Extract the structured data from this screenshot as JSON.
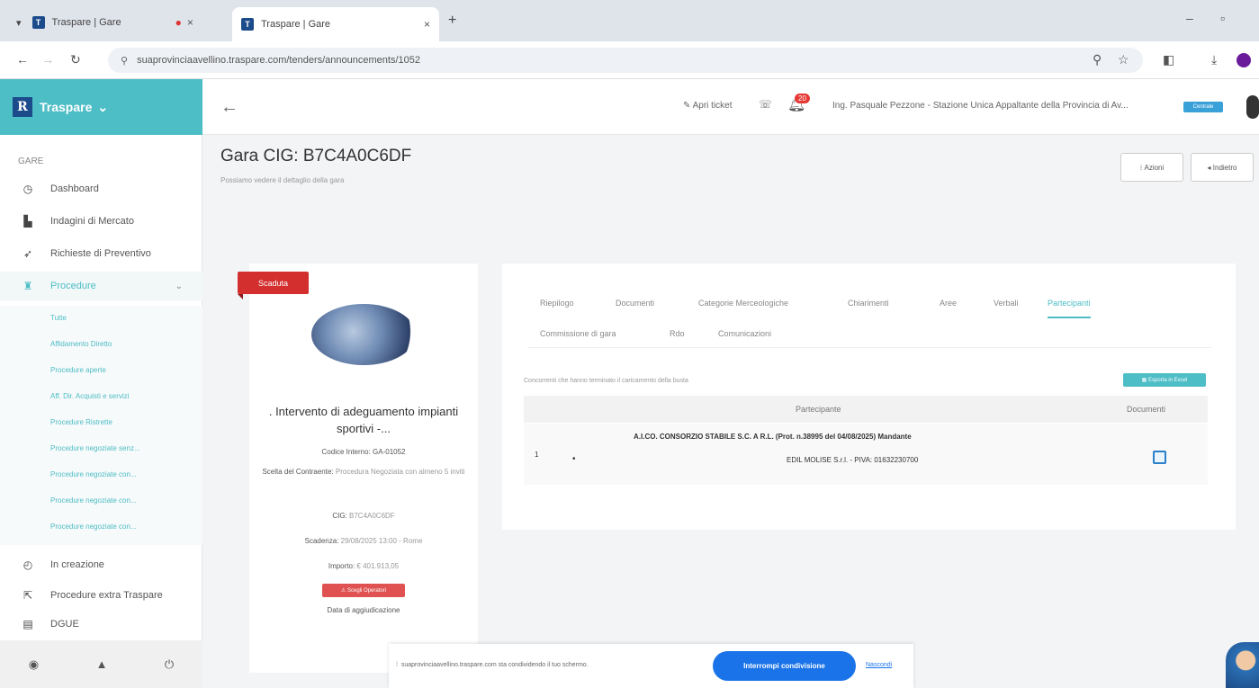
{
  "browser": {
    "tabs": [
      {
        "title": "Traspare | Gare"
      },
      {
        "title": "Traspare | Gare"
      }
    ],
    "url": "suaprovinciaavellino.traspare.com/tenders/announcements/1052"
  },
  "brand": {
    "name": "Traspare"
  },
  "topbar": {
    "ticket_label": "Apri ticket",
    "notif_count": "20",
    "user_org": "Ing. Pasquale Pezzone - Stazione Unica Appaltante della Provincia di Av...",
    "badge": "Centrale"
  },
  "sidebar": {
    "section": "GARE",
    "items": [
      {
        "label": "Dashboard",
        "icon": "dashboard-icon"
      },
      {
        "label": "Indagini di Mercato",
        "icon": "chart-icon"
      },
      {
        "label": "Richieste di Preventivo",
        "icon": "send-icon"
      },
      {
        "label": "Procedure",
        "icon": "trophy-icon"
      }
    ],
    "sub_items": [
      "Tutte",
      "Affidamento Diretto",
      "Procedure aperte",
      "Aff. Dir. Acquisti e servizi",
      "Procedure Ristrette",
      "Procedure negoziate senz...",
      "Procedure negoziate con...",
      "Procedure negoziate con...",
      "Procedure negoziate con..."
    ],
    "items_after": [
      {
        "label": "In creazione",
        "icon": "clock-icon"
      },
      {
        "label": "Procedure extra Traspare",
        "icon": "external-icon"
      },
      {
        "label": "DGUE",
        "icon": "document-icon"
      }
    ]
  },
  "page": {
    "title": "Gara CIG: B7C4A0C6DF",
    "subtitle": "Possiamo vedere il dettaglio della gara",
    "actions_label": "Azioni",
    "back_label": "Indietro"
  },
  "tender": {
    "status": "Scaduta",
    "title": ". Intervento di adeguamento impianti sportivi -...",
    "code_label": "Codice Interno:",
    "code_value": "GA-01052",
    "choice_label": "Scelta del Contraente:",
    "choice_value": "Procedura Negoziata con almeno 5 inviti",
    "cig_label": "CIG:",
    "cig_value": "B7C4A0C6DF",
    "deadline_label": "Scadenza:",
    "deadline_value": "29/08/2025 13:00 - Rome",
    "amount_label": "Importo:",
    "amount_value": "€ 401.913,05",
    "red_btn": "Scegli Operatori",
    "award_link": "Data di aggiudicazione"
  },
  "tabs_row1": [
    "Riepilogo",
    "Documenti",
    "Categorie Merceologiche",
    "Chiarimenti",
    "Aree",
    "Verbali",
    "Partecipanti"
  ],
  "tabs_row2": [
    "Commissione di gara",
    "Rdo",
    "Comunicazioni"
  ],
  "participants": {
    "note": "Concorrenti che hanno terminato il caricamento della busta",
    "export_label": "Esporta in Excel",
    "col_participant": "Partecipante",
    "col_documents": "Documenti",
    "rows": [
      {
        "index": "1",
        "name": "A.I.CO. CONSORZIO STABILE S.C. A R.L. (Prot. n.38995 del 04/08/2025) Mandante",
        "member": "EDIL MOLISE S.r.l. - PIVA: 01632230700"
      }
    ]
  },
  "sharebar": {
    "text": "suaprovinciaavellino.traspare.com sta condividendo il tuo schermo.",
    "stop_label": "Interrompi condivisione",
    "hide_label": "Nascondi"
  }
}
